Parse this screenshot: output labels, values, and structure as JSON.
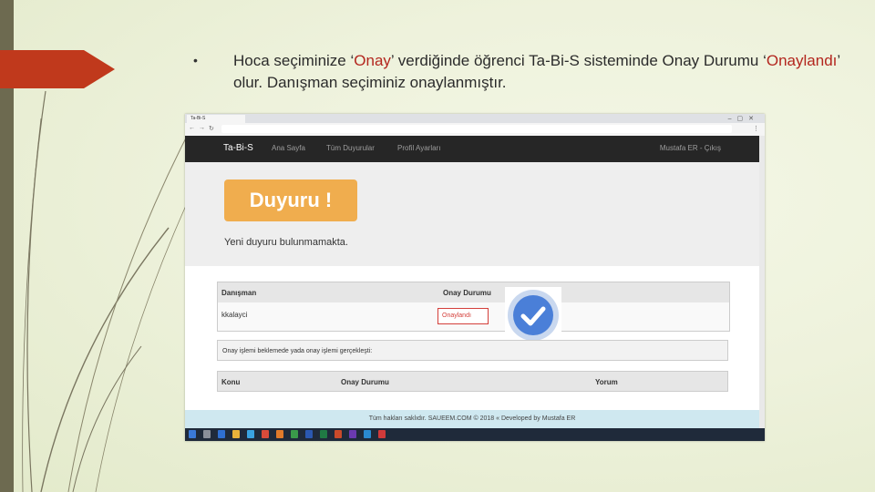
{
  "slide": {
    "bullet": "•",
    "text_before": "Hoca seçiminize ‘",
    "text_onay": "Onay",
    "text_middle": "’ verdiğinde öğrenci Ta-Bi-S sisteminde Onay Durumu ‘",
    "text_onaylandi": "Onaylandı",
    "text_after": "’ olur. Danışman seçiminiz onaylanmıştır."
  },
  "site": {
    "brand": "Ta-Bi-S",
    "nav": [
      "Ana Sayfa",
      "Tüm Duyurular",
      "Profil Ayarları"
    ],
    "user": "Mustafa ER - Çıkış",
    "announcement_button": "Duyuru !",
    "announcement_text": "Yeni duyuru bulunmamakta.",
    "advisor_table": {
      "headers": [
        "Danışman",
        "Onay Durumu"
      ],
      "row": {
        "advisor": "kkalayci",
        "status": "Onaylandı"
      }
    },
    "info_text": "Onay işlemi beklemede yada onay işlemi gerçekleşti:",
    "comments_table": {
      "headers": [
        "Konu",
        "Onay Durumu",
        "Yorum"
      ]
    },
    "footer": "Tüm hakları saklıdır. SAUEEM.COM © 2018 « Developed by Mustafa ER"
  },
  "colors": {
    "slide_accent": "#b3261e",
    "announce_orange": "#f0ad4e",
    "status_red": "#d43f3a",
    "check_blue": "#4a7fd8",
    "navbar": "#262626"
  }
}
